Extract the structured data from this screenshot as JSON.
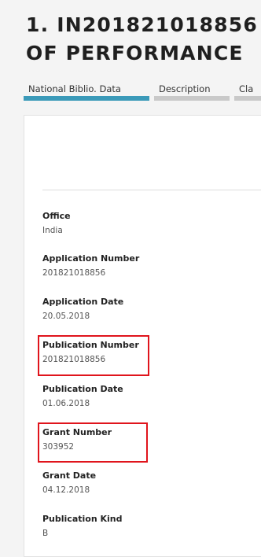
{
  "header": {
    "title_line1": "1. IN201821018856",
    "title_line2": "OF PERFORMANCE"
  },
  "tabs": [
    {
      "label": "National Biblio. Data",
      "active": true
    },
    {
      "label": "Description",
      "active": false
    },
    {
      "label": "Cla",
      "active": false
    }
  ],
  "fields": [
    {
      "label": "Office",
      "value": "India"
    },
    {
      "label": "Application Number",
      "value": "201821018856"
    },
    {
      "label": "Application Date",
      "value": "20.05.2018"
    },
    {
      "label": "Publication Number",
      "value": "201821018856",
      "highlighted": true
    },
    {
      "label": "Publication Date",
      "value": "01.06.2018"
    },
    {
      "label": "Grant Number",
      "value": "303952",
      "highlighted": true
    },
    {
      "label": "Grant Date",
      "value": "04.12.2018"
    },
    {
      "label": "Publication Kind",
      "value": "B"
    }
  ],
  "colors": {
    "active_tab": "#3b9ab9",
    "inactive_tab": "#c9c9c9",
    "highlight": "#e0141c"
  }
}
